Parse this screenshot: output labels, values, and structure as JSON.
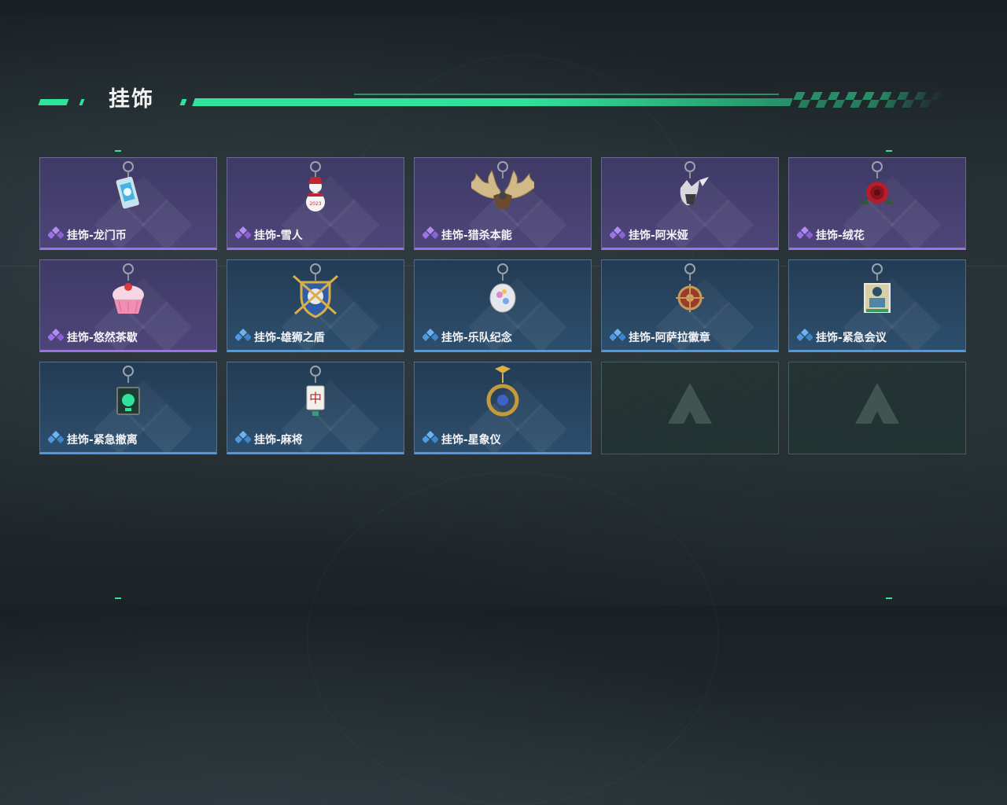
{
  "section": {
    "title": "挂饰"
  },
  "items": [
    {
      "label": "挂饰-龙门币",
      "rarity": "purple",
      "icon": "coin-charm-icon"
    },
    {
      "label": "挂饰-雪人",
      "rarity": "purple",
      "icon": "snowman-charm-icon"
    },
    {
      "label": "挂饰-猎杀本能",
      "rarity": "purple",
      "icon": "antler-charm-icon"
    },
    {
      "label": "挂饰-阿米娅",
      "rarity": "purple",
      "icon": "bunny-charm-icon"
    },
    {
      "label": "挂饰-绒花",
      "rarity": "purple",
      "icon": "rose-charm-icon"
    },
    {
      "label": "挂饰-悠然茶歇",
      "rarity": "purple",
      "icon": "cupcake-charm-icon"
    },
    {
      "label": "挂饰-雄狮之盾",
      "rarity": "blue",
      "icon": "lion-shield-charm-icon"
    },
    {
      "label": "挂饰-乐队纪念",
      "rarity": "blue",
      "icon": "band-badge-charm-icon"
    },
    {
      "label": "挂饰-阿萨拉徽章",
      "rarity": "blue",
      "icon": "wheel-badge-charm-icon"
    },
    {
      "label": "挂饰-紧急会议",
      "rarity": "blue",
      "icon": "meeting-board-charm-icon"
    },
    {
      "label": "挂饰-紧急撤离",
      "rarity": "blue",
      "icon": "exit-sign-charm-icon"
    },
    {
      "label": "挂饰-麻将",
      "rarity": "blue",
      "icon": "mahjong-charm-icon"
    },
    {
      "label": "挂饰-星象仪",
      "rarity": "blue",
      "icon": "astrolabe-charm-icon"
    },
    {
      "label": "",
      "rarity": "empty",
      "icon": "empty-slot-logo-icon"
    },
    {
      "label": "",
      "rarity": "empty",
      "icon": "empty-slot-logo-icon"
    }
  ],
  "colors": {
    "accent": "#2ee39a",
    "purple_rarity": "#9c72e6",
    "blue_rarity": "#4d9ae0"
  }
}
